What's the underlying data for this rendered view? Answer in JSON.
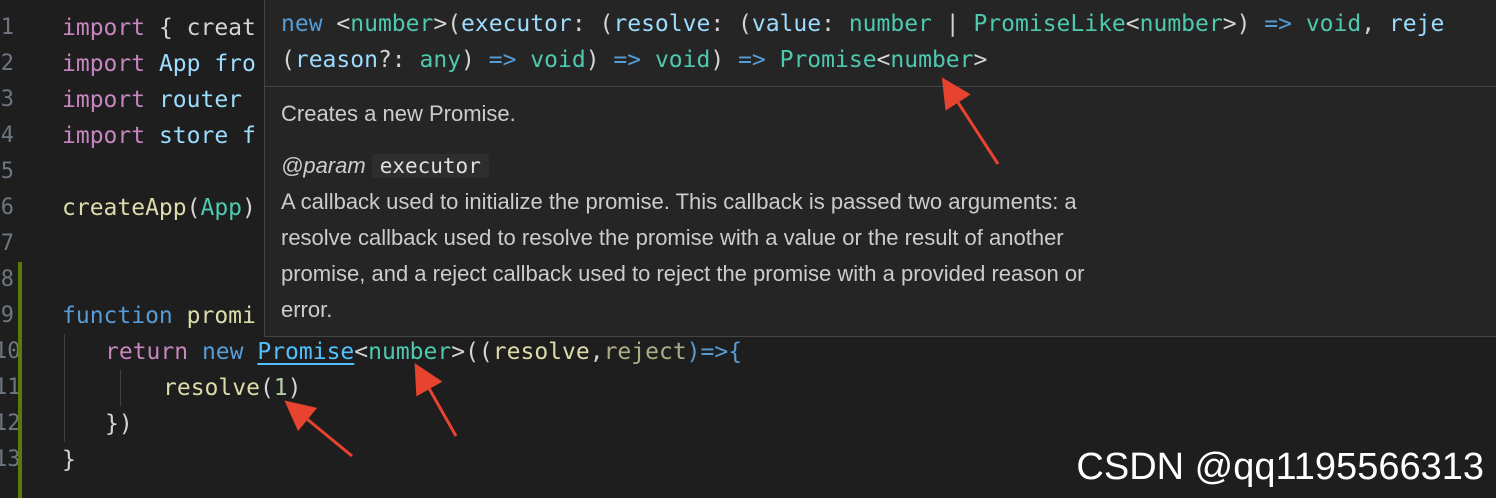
{
  "gutter": {
    "line_numbers": [
      "1",
      "2",
      "3",
      "4",
      "5",
      "6",
      "7",
      "8",
      "9",
      "10",
      "11",
      "12",
      "13"
    ]
  },
  "code": {
    "l1_kw": "import",
    "l1_rest": " { creat",
    "l2_kw": "import",
    "l2_rest": " App fro",
    "l3_kw": "import",
    "l3_rest": " router",
    "l4_kw": "import",
    "l4_rest": " store f",
    "l6_fn": "createApp",
    "l6_open": "(",
    "l6_arg": "App",
    "l6_close": ")",
    "l9_kw": "function",
    "l9_fn": " promi",
    "l10_ret": "return",
    "l10_new": " new ",
    "l10_promise": "Promise",
    "l10_lt": "<",
    "l10_type": "number",
    "l10_gt": ">((",
    "l10_p1": "resolve",
    "l10_comma": ",",
    "l10_p2": "reject",
    "l10_arrow": ")=>{",
    "l11_fn": "resolve",
    "l11_open": "(",
    "l11_num": "1",
    "l11_close": ")",
    "l12": "})",
    "l13": "}"
  },
  "hover": {
    "sig1_new": "new ",
    "sig1_lt": "<",
    "sig1_number1": "number",
    "sig1_gt": ">(",
    "sig1_executor": "executor",
    "sig1_colon": ": (",
    "sig1_resolve": "resolve",
    "sig1_colon2": ": (",
    "sig1_value": "value",
    "sig1_colon3": ": ",
    "sig1_number2": "number",
    "sig1_pipe": " | ",
    "sig1_promiselike": "PromiseLike",
    "sig1_lt2": "<",
    "sig1_number3": "number",
    "sig1_gt2": ">) ",
    "sig1_arrow": "=>",
    "sig1_void": " void",
    "sig1_comma": ", ",
    "sig1_reject": "reje",
    "sig2_open": "(",
    "sig2_reason": "reason",
    "sig2_q": "?: ",
    "sig2_any": "any",
    "sig2_close": ") ",
    "sig2_arrow1": "=>",
    "sig2_void1": " void",
    "sig2_close2": ") ",
    "sig2_arrow2": "=>",
    "sig2_void2": " void",
    "sig2_close3": ") ",
    "sig2_arrow3": "=>",
    "sig2_promise": " Promise",
    "sig2_lt": "<",
    "sig2_number": "number",
    "sig2_gt": ">",
    "description": "Creates a new Promise.",
    "param_tag": "@param",
    "param_name": "executor",
    "param_doc": [
      "A callback used to initialize the promise. This callback is passed two arguments: a",
      "resolve callback used to resolve the promise with a value or the result of another",
      "promise, and a reject callback used to reject the promise with a provided reason or",
      "error."
    ]
  },
  "watermark": "CSDN @qq1195566313",
  "colors": {
    "background": "#1e1e1e",
    "hover_bg": "#252526",
    "keyword": "#c586c0",
    "storage": "#569cd6",
    "function": "#dcdcaa",
    "variable": "#9cdcfe",
    "type": "#4ec9b0",
    "number": "#b5cea8",
    "annotation_arrow": "#e8432e"
  }
}
